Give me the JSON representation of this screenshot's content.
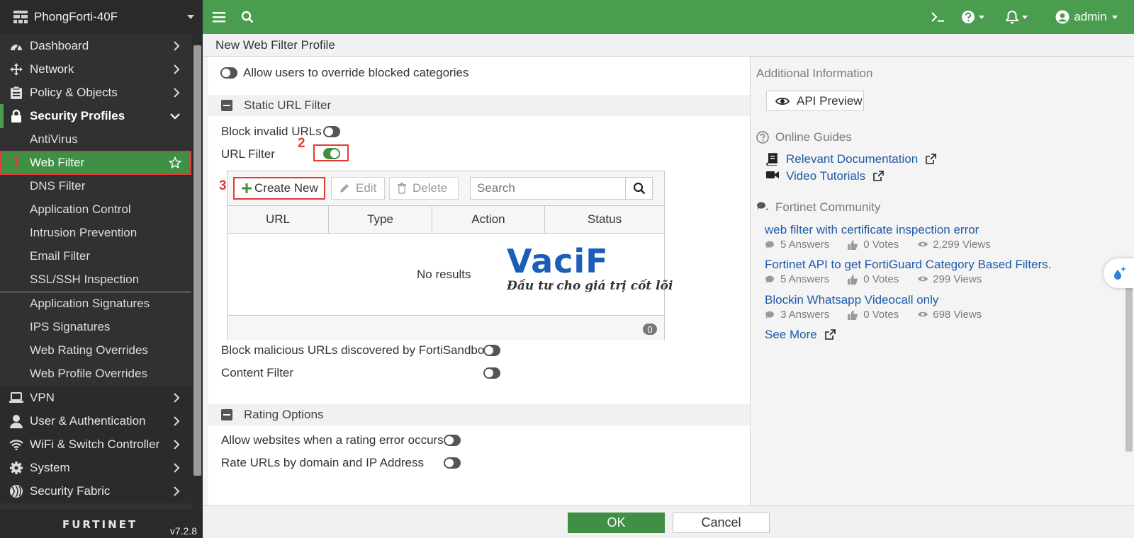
{
  "device": {
    "name": "PhongForti-40F"
  },
  "colors": {
    "brand_green": "#4a9c4f",
    "sidebar_bg": "#313131",
    "highlight_red": "#e53935",
    "link_blue": "#1e5aa8"
  },
  "nav": {
    "dashboard": "Dashboard",
    "network": "Network",
    "policy_objects": "Policy & Objects",
    "security_profiles": "Security Profiles",
    "antivirus": "AntiVirus",
    "web_filter": "Web Filter",
    "web_filter_marker": "1",
    "dns_filter": "DNS Filter",
    "application_control": "Application Control",
    "intrusion_prevention": "Intrusion Prevention",
    "email_filter": "Email Filter",
    "ssl_ssh_inspection": "SSL/SSH Inspection",
    "application_signatures": "Application Signatures",
    "ips_signatures": "IPS Signatures",
    "web_rating_overrides": "Web Rating Overrides",
    "web_profile_overrides": "Web Profile Overrides",
    "vpn": "VPN",
    "user_authentication": "User & Authentication",
    "wifi_switch": "WiFi & Switch Controller",
    "system": "System",
    "security_fabric": "Security Fabric"
  },
  "footer": {
    "logo": "FURTINET",
    "version": "v7.2.8"
  },
  "topbar": {
    "user": "admin"
  },
  "page": {
    "title": "New Web Filter Profile"
  },
  "form": {
    "allow_override_label": "Allow users to override blocked categories",
    "static_url_section": "Static URL Filter",
    "block_invalid_label": "Block invalid URLs",
    "url_filter_label": "URL Filter",
    "url_filter_marker": "2",
    "create_new_marker": "3",
    "toolbar": {
      "create_new": "Create New",
      "edit": "Edit",
      "delete": "Delete",
      "search_placeholder": "Search"
    },
    "table": {
      "columns": [
        "URL",
        "Type",
        "Action",
        "Status"
      ],
      "empty_text": "No results",
      "count": "0"
    },
    "block_malicious_label": "Block malicious URLs discovered by FortiSandbox",
    "content_filter_label": "Content Filter",
    "rating_section": "Rating Options",
    "allow_rating_error_label": "Allow websites when a rating error occurs",
    "rate_by_domain_label": "Rate URLs by domain and IP Address",
    "toggles": {
      "allow_override": false,
      "block_invalid": false,
      "url_filter": true,
      "block_malicious": false,
      "content_filter": false,
      "allow_rating_error": false,
      "rate_by_domain": false
    }
  },
  "watermark": {
    "logo": "VaciF",
    "tagline": "Đầu tư cho giá trị cốt lõi"
  },
  "side_panel": {
    "additional_info": "Additional Information",
    "api_preview": "API Preview",
    "online_guides": "Online Guides",
    "relevant_docs": "Relevant Documentation",
    "video_tutorials": "Video Tutorials",
    "community": "Fortinet Community",
    "posts": [
      {
        "title": "web filter with certificate inspection error",
        "answers": "5  Answers",
        "votes": "0  Votes",
        "views": "2,299  Views"
      },
      {
        "title": "Fortinet API to get FortiGuard Category Based Filters.",
        "answers": "5  Answers",
        "votes": "0  Votes",
        "views": "299  Views"
      },
      {
        "title": "Blockin Whatsapp Videocall only",
        "answers": "3  Answers",
        "votes": "0  Votes",
        "views": "698  Views"
      }
    ],
    "see_more": "See More"
  },
  "buttons": {
    "ok": "OK",
    "cancel": "Cancel"
  }
}
